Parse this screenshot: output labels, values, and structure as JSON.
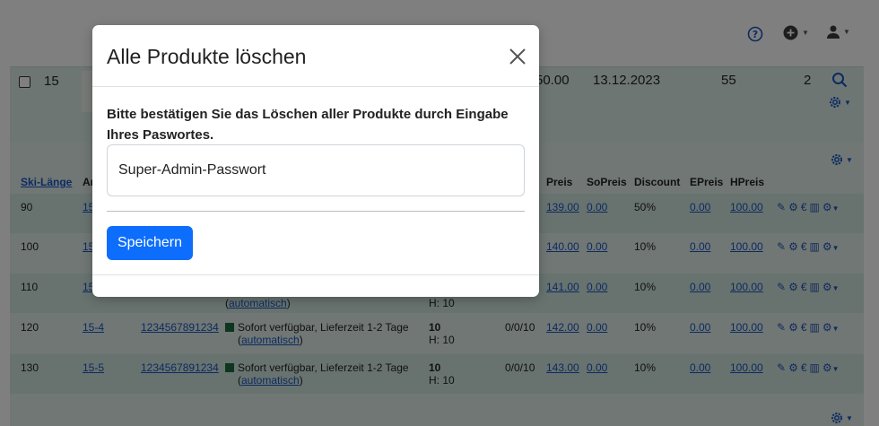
{
  "product_row": {
    "id": "15",
    "price": "50.00",
    "date": "13.12.2023",
    "quantity": "55",
    "count": "2"
  },
  "variants_table": {
    "headers": [
      {
        "label": "Ski-Länge",
        "link": true
      },
      {
        "label": "Ar",
        "link": false
      },
      {
        "label": "Preis",
        "link": false
      },
      {
        "label": "SoPreis",
        "link": false
      },
      {
        "label": "Discount",
        "link": false
      },
      {
        "label": "EPreis",
        "link": false
      },
      {
        "label": "HPreis",
        "link": false
      }
    ],
    "rows": [
      {
        "length": "90",
        "art": "15",
        "ean": "",
        "status": "",
        "auto": "",
        "stock": "",
        "h": "",
        "range": "",
        "preis": "139.00",
        "sopreis": "0.00",
        "discount": "50%",
        "epreis": "0.00",
        "hpreis": "100.00"
      },
      {
        "length": "100",
        "art": "15",
        "ean": "",
        "status": "",
        "auto": "",
        "stock": "",
        "h": "",
        "range": "",
        "preis": "140.00",
        "sopreis": "0.00",
        "discount": "10%",
        "epreis": "0.00",
        "hpreis": "100.00"
      },
      {
        "length": "110",
        "art": "15",
        "ean": "",
        "status": "",
        "auto": "automatisch",
        "stock": "",
        "h": "H: 10",
        "range": "",
        "preis": "141.00",
        "sopreis": "0.00",
        "discount": "10%",
        "epreis": "0.00",
        "hpreis": "100.00"
      },
      {
        "length": "120",
        "art": "15-4",
        "ean": "1234567891234",
        "status": "Sofort verfügbar, Lieferzeit 1-2 Tage",
        "auto": "automatisch",
        "stock": "10",
        "h": "H: 10",
        "range": "0/0/10",
        "preis": "142.00",
        "sopreis": "0.00",
        "discount": "10%",
        "epreis": "0.00",
        "hpreis": "100.00"
      },
      {
        "length": "130",
        "art": "15-5",
        "ean": "1234567891234",
        "status": "Sofort verfügbar, Lieferzeit 1-2 Tage",
        "auto": "automatisch",
        "stock": "10",
        "h": "H: 10",
        "range": "0/0/10",
        "preis": "143.00",
        "sopreis": "0.00",
        "discount": "10%",
        "epreis": "0.00",
        "hpreis": "100.00"
      }
    ],
    "action_icons": [
      "pencil-icon",
      "cogs-icon",
      "euro-icon",
      "barcode-icon",
      "gear-icon"
    ]
  },
  "modal": {
    "title": "Alle Produkte löschen",
    "message": "Bitte bestätigen Sie das Löschen aller Produkte durch Eingabe Ihres Paswortes.",
    "password_value": "Super-Admin-Passwort",
    "save_label": "Speichern"
  },
  "colors": {
    "primary": "#0d6efd",
    "row_bg": "#dcede8",
    "row_alt_bg": "#d1e6de",
    "status_green": "#1d6b3e",
    "link": "#1a55c4"
  }
}
